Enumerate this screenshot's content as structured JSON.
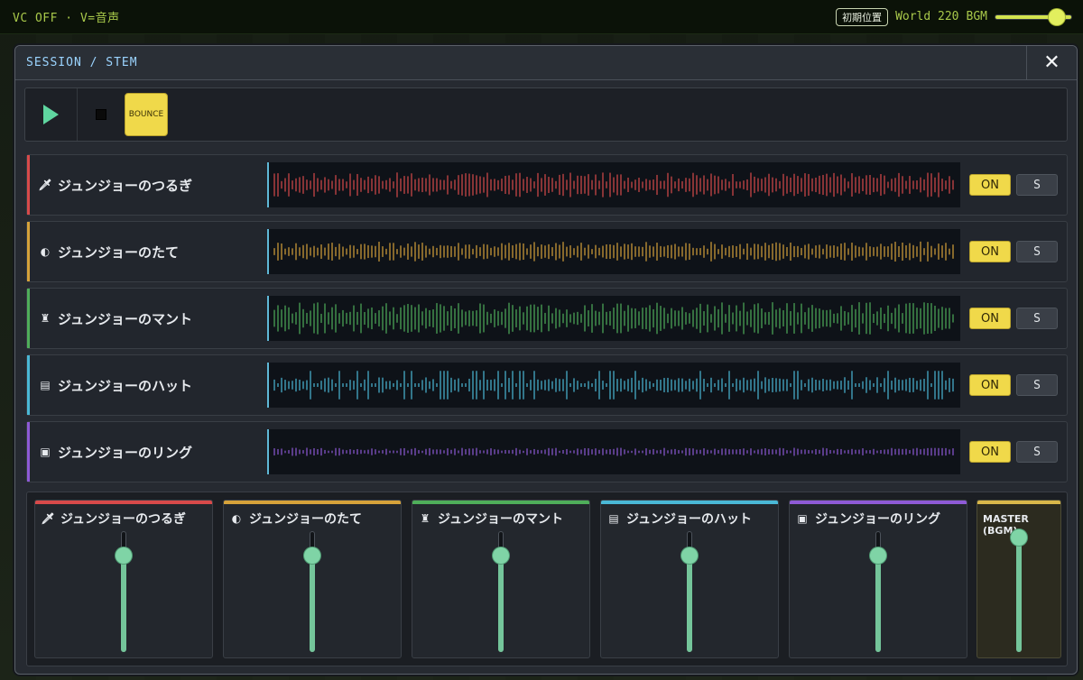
{
  "topbar": {
    "left_text": "VC OFF · V=音声",
    "position_button": "初期位置",
    "world": "World 220",
    "bgm_label": "BGM",
    "bgm_level": 0.88
  },
  "panel": {
    "title": "SESSION / STEM",
    "close_glyph": "✕"
  },
  "transport": {
    "bounce_label": "BOUNCE"
  },
  "colors": {
    "sword": "#d84a4a",
    "shield": "#d6a23a",
    "mantle": "#4fae5a",
    "hat": "#4ab8d6",
    "ring": "#8e5ad6",
    "master": "#d9b74a"
  },
  "tracks": [
    {
      "name": "ジュンジョーのつるぎ",
      "icon": "sword-icon",
      "glyph": "🗡",
      "on": "ON",
      "solo": "S",
      "color": "#d84a4a"
    },
    {
      "name": "ジュンジョーのたて",
      "icon": "shield-icon",
      "glyph": "◐",
      "on": "ON",
      "solo": "S",
      "color": "#d6a23a"
    },
    {
      "name": "ジュンジョーのマント",
      "icon": "mantle-icon",
      "glyph": "♜",
      "on": "ON",
      "solo": "S",
      "color": "#4fae5a"
    },
    {
      "name": "ジュンジョーのハット",
      "icon": "hat-icon",
      "glyph": "▤",
      "on": "ON",
      "solo": "S",
      "color": "#4ab8d6"
    },
    {
      "name": "ジュンジョーのリング",
      "icon": "ring-icon",
      "glyph": "▣",
      "on": "ON",
      "solo": "S",
      "color": "#8e5ad6"
    }
  ],
  "mixer": {
    "strips": [
      {
        "name": "ジュンジョーのつるぎ",
        "level": 0.8
      },
      {
        "name": "ジュンジョーのたて",
        "level": 0.8
      },
      {
        "name": "ジュンジョーのマント",
        "level": 0.8
      },
      {
        "name": "ジュンジョーのハット",
        "level": 0.8
      },
      {
        "name": "ジュンジョーのリング",
        "level": 0.8
      }
    ],
    "master": {
      "name": "MASTER (BGM)",
      "level": 0.95
    }
  }
}
